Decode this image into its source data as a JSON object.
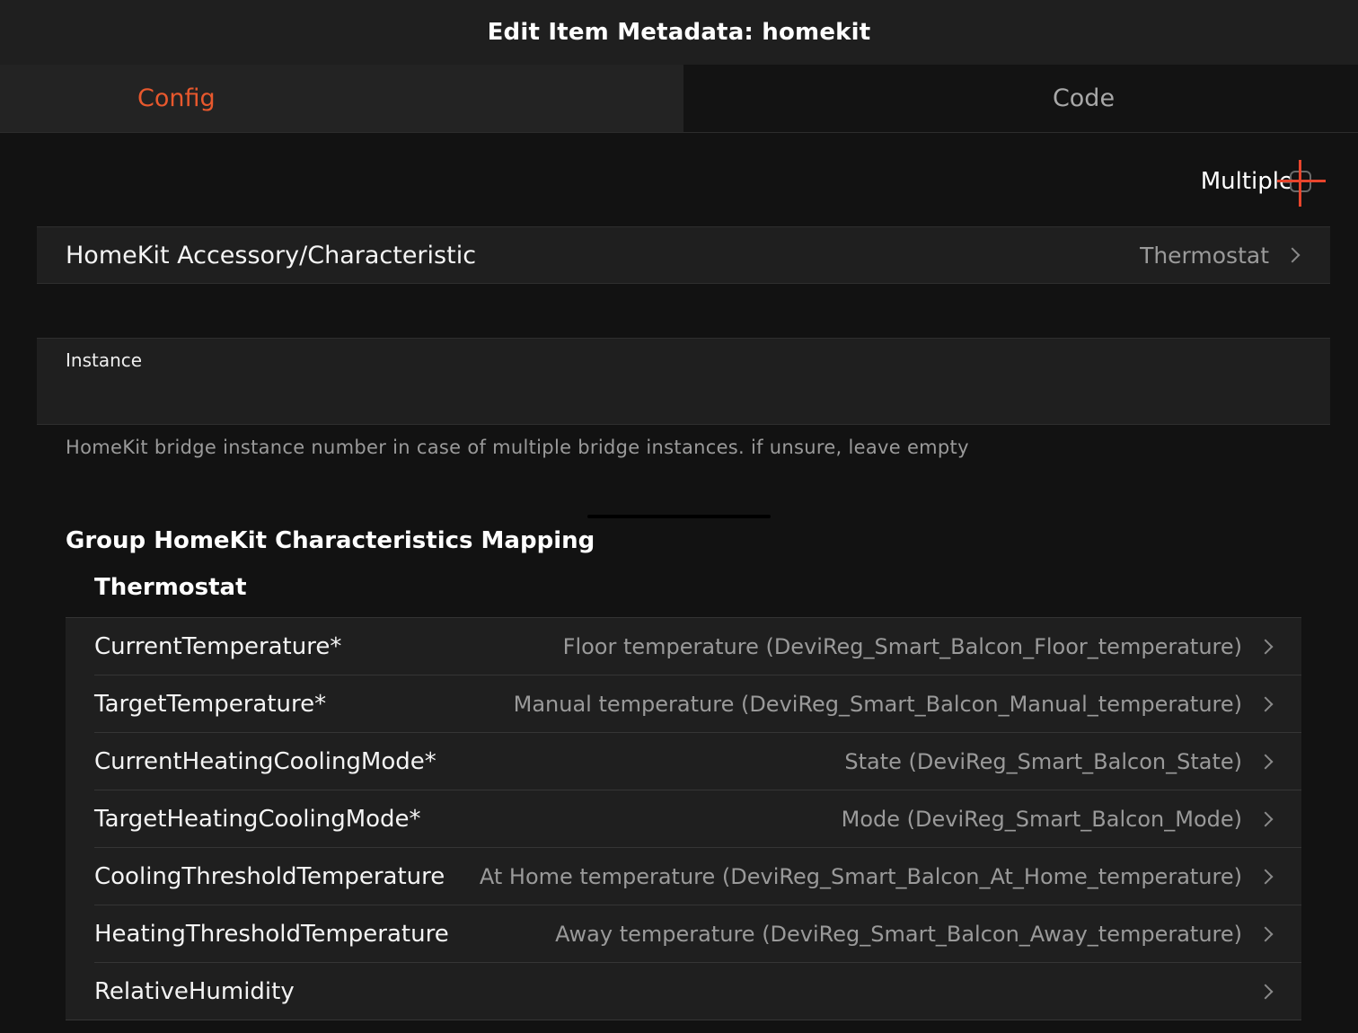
{
  "window": {
    "title": "Edit Item Metadata: homekit"
  },
  "tabs": [
    {
      "label": "Config",
      "active": true
    },
    {
      "label": "Code",
      "active": false
    }
  ],
  "multiple": {
    "label": "Multiple",
    "checked": false
  },
  "accessory": {
    "label": "HomeKit Accessory/Characteristic",
    "value": "Thermostat"
  },
  "instance": {
    "label": "Instance",
    "value": "",
    "placeholder": "",
    "hint": "HomeKit bridge instance number in case of multiple bridge instances. if unsure, leave empty"
  },
  "group": {
    "title": "Group HomeKit Characteristics Mapping",
    "subtitle": "Thermostat",
    "rows": [
      {
        "name": "CurrentTemperature*",
        "value": "Floor temperature (DeviReg_Smart_Balcon_Floor_temperature)"
      },
      {
        "name": "TargetTemperature*",
        "value": "Manual temperature (DeviReg_Smart_Balcon_Manual_temperature)"
      },
      {
        "name": "CurrentHeatingCoolingMode*",
        "value": "State (DeviReg_Smart_Balcon_State)"
      },
      {
        "name": "TargetHeatingCoolingMode*",
        "value": "Mode (DeviReg_Smart_Balcon_Mode)"
      },
      {
        "name": "CoolingThresholdTemperature",
        "value": "At Home temperature (DeviReg_Smart_Balcon_At_Home_temperature)"
      },
      {
        "name": "HeatingThresholdTemperature",
        "value": "Away temperature (DeviReg_Smart_Balcon_Away_temperature)"
      },
      {
        "name": "RelativeHumidity",
        "value": ""
      }
    ]
  },
  "colors": {
    "accent": "#e8582d",
    "background": "#121212",
    "cell": "#1f1f1f",
    "secondary_text": "#9a9a9a"
  }
}
